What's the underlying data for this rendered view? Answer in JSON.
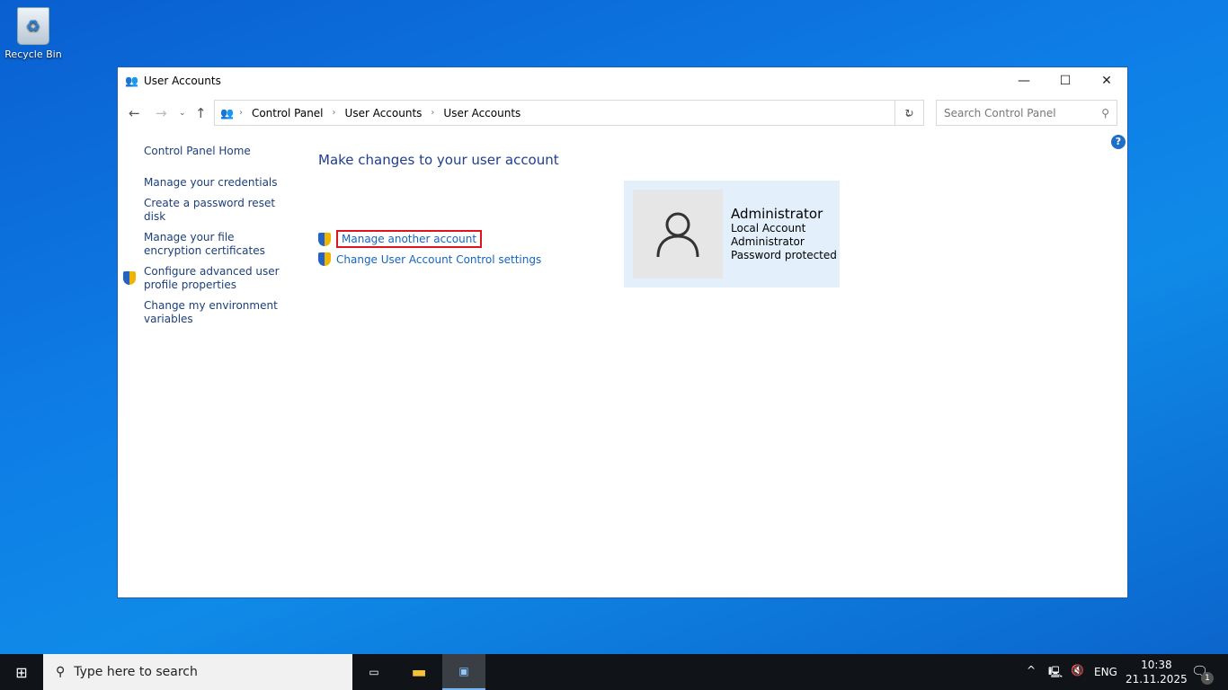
{
  "desktop": {
    "recycle_bin": "Recycle Bin"
  },
  "window": {
    "title": "User Accounts",
    "controls": {
      "minimize": "—",
      "maximize": "☐",
      "close": "✕"
    }
  },
  "address": {
    "breadcrumbs": [
      "Control Panel",
      "User Accounts",
      "User Accounts"
    ],
    "search_placeholder": "Search Control Panel"
  },
  "sidebar": {
    "items": [
      {
        "label": "Control Panel Home"
      },
      {
        "label": "Manage your credentials"
      },
      {
        "label": "Create a password reset disk"
      },
      {
        "label": "Manage your file encryption certificates"
      },
      {
        "label": "Configure advanced user profile properties",
        "shield": true
      },
      {
        "label": "Change my environment variables"
      }
    ]
  },
  "main": {
    "heading": "Make changes to your user account",
    "tasks": [
      {
        "label": "Manage another account",
        "highlighted": true
      },
      {
        "label": "Change User Account Control settings"
      }
    ]
  },
  "account": {
    "name": "Administrator",
    "type": "Local Account",
    "role": "Administrator",
    "status": "Password protected"
  },
  "taskbar": {
    "search_placeholder": "Type here to search",
    "lang": "ENG",
    "time": "10:38",
    "date": "21.11.2025",
    "notifications": "1"
  },
  "colors": {
    "link": "#1565c0",
    "heading": "#1e3e8f",
    "highlight": "#e0141e",
    "card": "#e3f0fb"
  }
}
